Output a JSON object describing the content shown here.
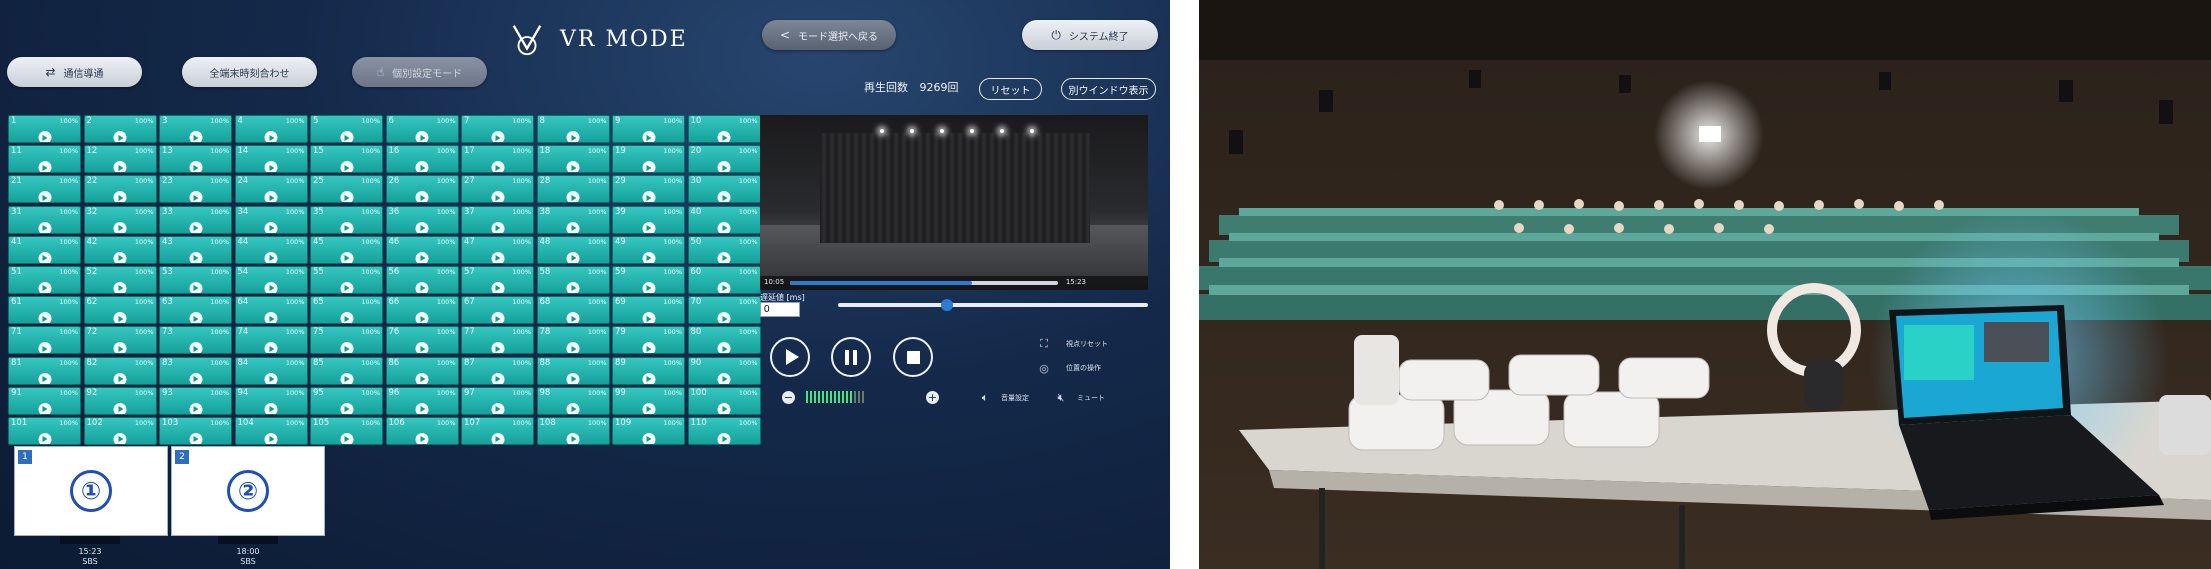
{
  "app": {
    "brand": "VR MODE",
    "top_buttons": {
      "back_to_mode": "モード選択へ戻る",
      "system_exit": "システム終了"
    },
    "toolbar": {
      "comm_check": "通信導通",
      "time_sync": "全端末時刻合わせ",
      "individual_mode": "個別設定モード"
    },
    "playback": {
      "count_label": "再生回数",
      "count_value": "9269回",
      "reset": "リセット",
      "separate_window": "別ウインドウ表示"
    },
    "tiles": {
      "percent": "100%",
      "numbers": [
        "1",
        "2",
        "3",
        "4",
        "5",
        "6",
        "7",
        "8",
        "9",
        "10",
        "11",
        "12",
        "13",
        "14",
        "15",
        "16",
        "17",
        "18",
        "19",
        "20",
        "21",
        "22",
        "23",
        "24",
        "25",
        "26",
        "27",
        "28",
        "29",
        "30",
        "31",
        "32",
        "33",
        "34",
        "35",
        "36",
        "37",
        "38",
        "39",
        "40",
        "41",
        "42",
        "43",
        "44",
        "45",
        "46",
        "47",
        "48",
        "49",
        "50",
        "51",
        "52",
        "53",
        "54",
        "55",
        "56",
        "57",
        "58",
        "59",
        "60",
        "61",
        "62",
        "63",
        "64",
        "65",
        "66",
        "67",
        "68",
        "69",
        "70",
        "71",
        "72",
        "73",
        "74",
        "75",
        "76",
        "77",
        "78",
        "79",
        "80",
        "81",
        "82",
        "83",
        "84",
        "85",
        "86",
        "87",
        "88",
        "89",
        "90",
        "91",
        "92",
        "93",
        "94",
        "95",
        "96",
        "97",
        "98",
        "99",
        "100",
        "101",
        "102",
        "103",
        "104",
        "105",
        "106",
        "107",
        "108",
        "109",
        "110"
      ]
    },
    "slots": [
      {
        "num": "1",
        "circle": "①",
        "time": "15:23",
        "label": "SBS"
      },
      {
        "num": "2",
        "circle": "②",
        "time": "18:00",
        "label": "SBS"
      }
    ],
    "preview": {
      "time_current": "10:05",
      "time_total": "15:23",
      "progress": 0.68
    },
    "delay": {
      "label": "遅延値 [ms]",
      "value": "0",
      "slider_position": 0.35
    },
    "side_controls": {
      "view_reset": "視点リセット",
      "origin_op": "位置の操作",
      "volume_setting": "音量設定",
      "mute": "ミュート"
    },
    "volume": {
      "level_bars_on": 12,
      "level_bars_total": 15
    },
    "colors": {
      "background": "#14294a",
      "tile": "#1fb3ad",
      "accent": "#2b7bd3"
    }
  }
}
